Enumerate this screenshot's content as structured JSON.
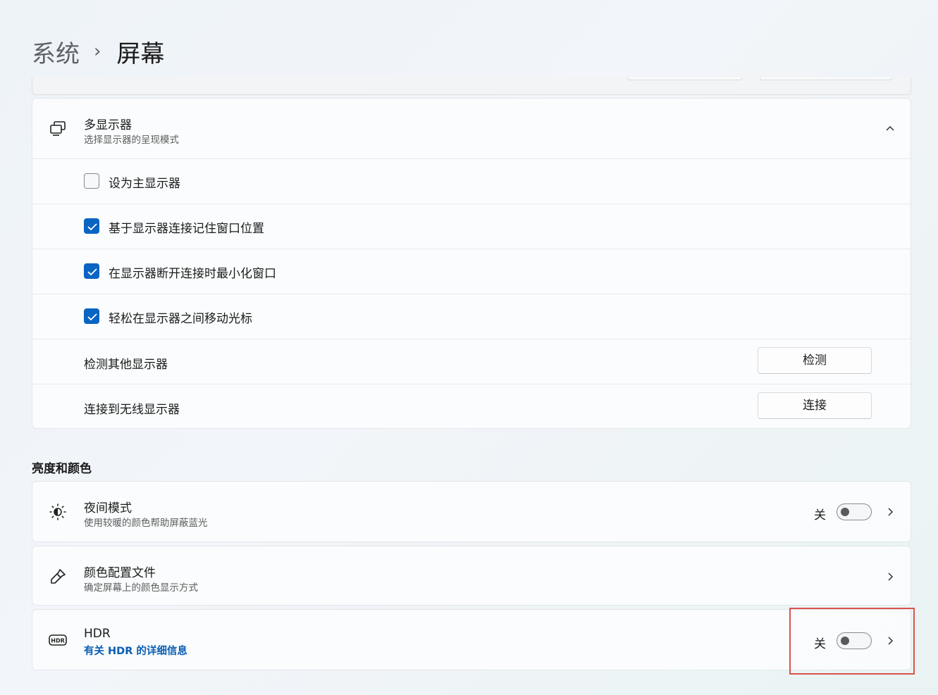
{
  "breadcrumb": {
    "parent": "系统",
    "separator": "›",
    "current": "屏幕"
  },
  "multi_display": {
    "title": "多显示器",
    "subtitle": "选择显示器的呈现模式",
    "options": [
      {
        "label": "设为主显示器",
        "checked": false
      },
      {
        "label": "基于显示器连接记住窗口位置",
        "checked": true
      },
      {
        "label": "在显示器断开连接时最小化窗口",
        "checked": true
      },
      {
        "label": "轻松在显示器之间移动光标",
        "checked": true
      }
    ],
    "detect": {
      "label": "检测其他显示器",
      "button": "检测"
    },
    "wireless": {
      "label": "连接到无线显示器",
      "button": "连接"
    }
  },
  "brightness_section": {
    "title": "亮度和颜色",
    "night_mode": {
      "title": "夜间模式",
      "subtitle": "使用较暖的颜色帮助屏蔽蓝光",
      "state": "关"
    },
    "color_profile": {
      "title": "颜色配置文件",
      "subtitle": "确定屏幕上的颜色显示方式"
    },
    "hdr": {
      "title": "HDR",
      "link": "有关 HDR 的详细信息",
      "state": "关"
    }
  },
  "colors": {
    "accent": "#0a64c2",
    "link": "#0a5db4",
    "highlight": "#d9534a"
  }
}
